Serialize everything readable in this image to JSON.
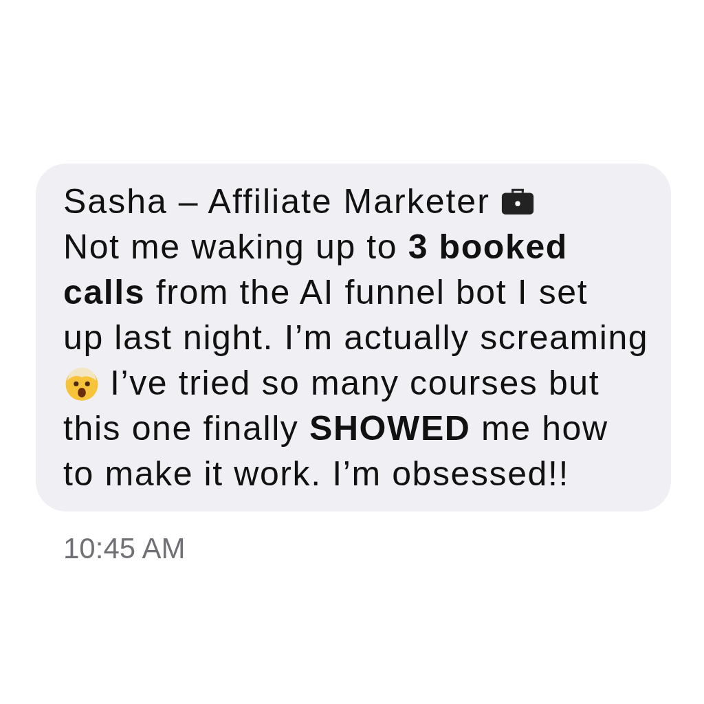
{
  "message": {
    "sender": "Sasha – Affiliate Marketer",
    "lines": [
      {
        "emoji": false,
        "text": "Not me waking up to **3 booked**"
      },
      {
        "emoji": false,
        "text": "**calls** from the AI funnel bot I set"
      },
      {
        "emoji": false,
        "text": "up last night. I’m actually screaming"
      },
      {
        "emoji": true,
        "text": "I’ve tried so many courses but"
      },
      {
        "emoji": false,
        "text": "this one finally **SHOWED** me how"
      },
      {
        "emoji": false,
        "text": "to make it work. I’m obsessed!!"
      }
    ],
    "time": "10:45 AM"
  }
}
